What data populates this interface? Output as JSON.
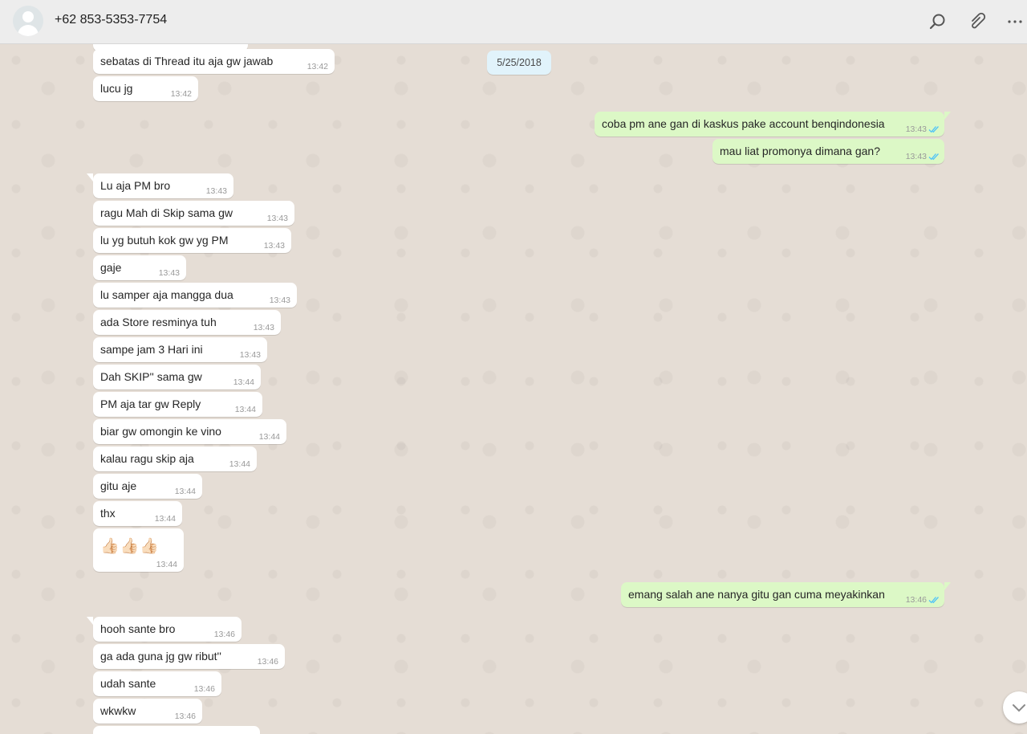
{
  "header": {
    "contact_name": "+62 853-5353-7754",
    "icons": [
      "search-icon",
      "attach-icon",
      "menu-icon"
    ]
  },
  "chat": {
    "date_divider": "5/25/2018",
    "messages": [
      {
        "dir": "in",
        "text": "sebatas di Thread itu aja gw jawab",
        "time": "13:42"
      },
      {
        "dir": "in",
        "text": "lucu jg",
        "time": "13:42"
      },
      {
        "dir": "out",
        "text": "coba pm ane gan di kaskus pake account benqindonesia",
        "time": "13:43",
        "read": true
      },
      {
        "dir": "out",
        "text": "mau liat promonya dimana gan?",
        "time": "13:43",
        "read": true
      },
      {
        "dir": "in",
        "text": "Lu aja PM bro",
        "time": "13:43"
      },
      {
        "dir": "in",
        "text": "ragu Mah di Skip sama gw",
        "time": "13:43"
      },
      {
        "dir": "in",
        "text": "lu yg butuh kok gw yg PM",
        "time": "13:43"
      },
      {
        "dir": "in",
        "text": "gaje",
        "time": "13:43"
      },
      {
        "dir": "in",
        "text": "lu samper aja mangga dua",
        "time": "13:43"
      },
      {
        "dir": "in",
        "text": "ada Store resminya tuh",
        "time": "13:43"
      },
      {
        "dir": "in",
        "text": "sampe jam 3 Hari ini",
        "time": "13:43"
      },
      {
        "dir": "in",
        "text": "Dah SKIP'' sama gw",
        "time": "13:44"
      },
      {
        "dir": "in",
        "text": "PM aja tar gw Reply",
        "time": "13:44"
      },
      {
        "dir": "in",
        "text": "biar gw omongin ke vino",
        "time": "13:44"
      },
      {
        "dir": "in",
        "text": "kalau ragu skip aja",
        "time": "13:44"
      },
      {
        "dir": "in",
        "text": "gitu aje",
        "time": "13:44"
      },
      {
        "dir": "in",
        "text": "thx",
        "time": "13:44"
      },
      {
        "dir": "in",
        "text": "👍🏻👍🏻👍🏻",
        "time": "13:44"
      },
      {
        "dir": "out",
        "text": "emang salah ane nanya gitu gan cuma meyakinkan",
        "time": "13:46",
        "read": true
      },
      {
        "dir": "in",
        "text": "hooh sante bro",
        "time": "13:46"
      },
      {
        "dir": "in",
        "text": "ga ada guna jg gw ribut''",
        "time": "13:46"
      },
      {
        "dir": "in",
        "text": "udah sante",
        "time": "13:46"
      },
      {
        "dir": "in",
        "text": "wkwkw",
        "time": "13:46"
      }
    ]
  },
  "colors": {
    "chat_bg": "#e5ddd5",
    "incoming_bubble": "#ffffff",
    "outgoing_bubble": "#dcf8c6",
    "read_ticks": "#4fc3f7",
    "date_chip": "#e1f3fb"
  }
}
